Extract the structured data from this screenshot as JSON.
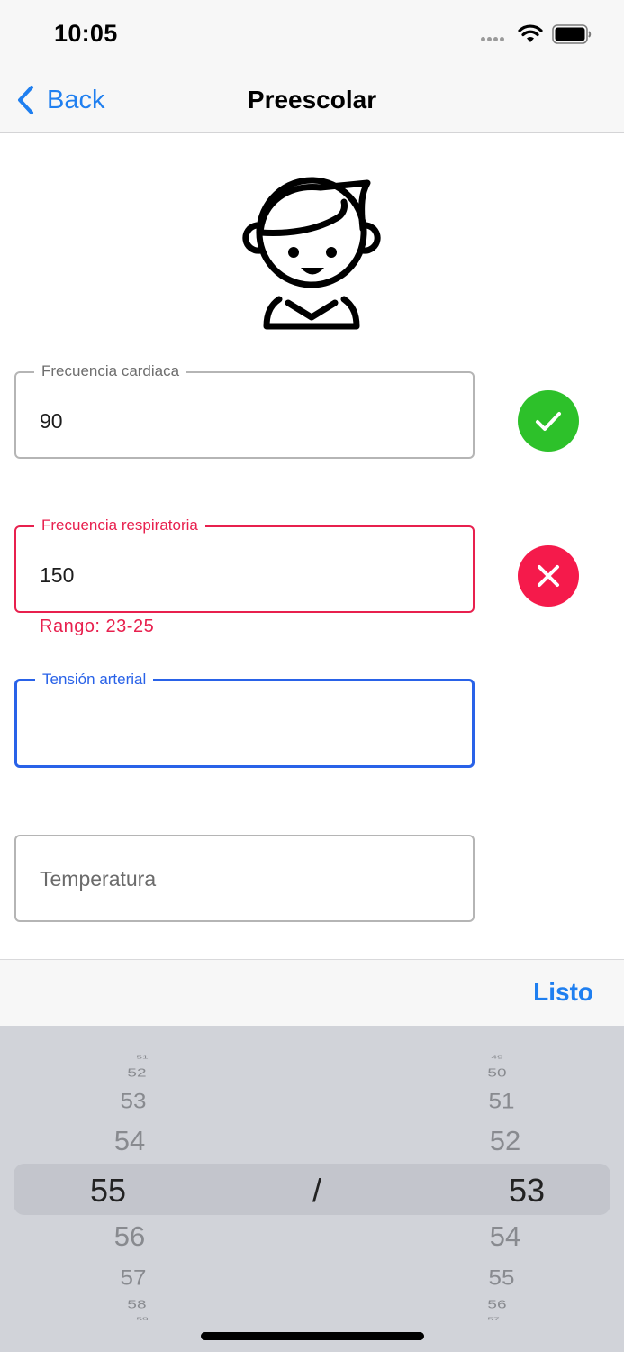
{
  "status_bar": {
    "time": "10:05"
  },
  "nav": {
    "back_label": "Back",
    "title": "Preescolar"
  },
  "fields": {
    "heart_rate": {
      "label": "Frecuencia cardiaca",
      "value": "90",
      "status": "valid"
    },
    "respiratory_rate": {
      "label": "Frecuencia respiratoria",
      "value": "150",
      "status": "invalid",
      "error": "Rango: 23-25"
    },
    "blood_pressure": {
      "label": "Tensión arterial",
      "value": "",
      "status": "focused"
    },
    "temperature": {
      "placeholder": "Temperatura",
      "value": ""
    }
  },
  "toolbar": {
    "done_label": "Listo"
  },
  "picker": {
    "left_column": {
      "above": [
        "51",
        "52",
        "53",
        "54"
      ],
      "selected": "55",
      "below": [
        "56",
        "57",
        "58",
        "59"
      ]
    },
    "separator": "/",
    "right_column": {
      "above": [
        "49",
        "50",
        "51",
        "52"
      ],
      "selected": "53",
      "below": [
        "54",
        "55",
        "56",
        "57"
      ]
    }
  },
  "colors": {
    "accent": "#1f7ff0",
    "valid": "#2dc12a",
    "error": "#f51a4b",
    "focus": "#2962e8"
  }
}
